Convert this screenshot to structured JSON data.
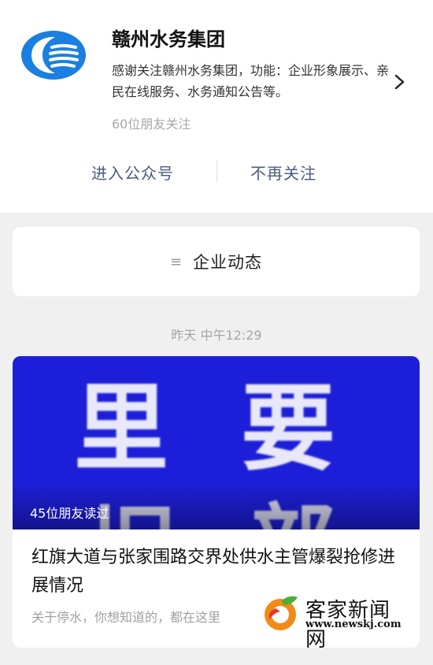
{
  "profile": {
    "name": "赣州水务集团",
    "description": "感谢关注赣州水务集团，功能：企业形象展示、亲民在线服务、水务通知公告等。",
    "followers": "60位朋友关注",
    "enter_label": "进入公众号",
    "unfollow_label": "不再关注"
  },
  "menu": {
    "icon": "menu-lines-icon",
    "label": "企业动态"
  },
  "timestamp": "昨天 中午12:29",
  "article": {
    "cover_chars": [
      "里",
      "要",
      "旧",
      "部"
    ],
    "read_count": "45位朋友读过",
    "title": "红旗大道与张家围路交界处供水主管爆裂抢修进展情况",
    "summary": "关于停水，你想知道的，都在这里"
  },
  "watermark": {
    "text": "客家新闻网",
    "url": "www.newskj.com"
  },
  "colors": {
    "brand_blue": "#1a7fe0",
    "cover_blue": "#1d1fd8",
    "action_text": "#4b5b80"
  }
}
